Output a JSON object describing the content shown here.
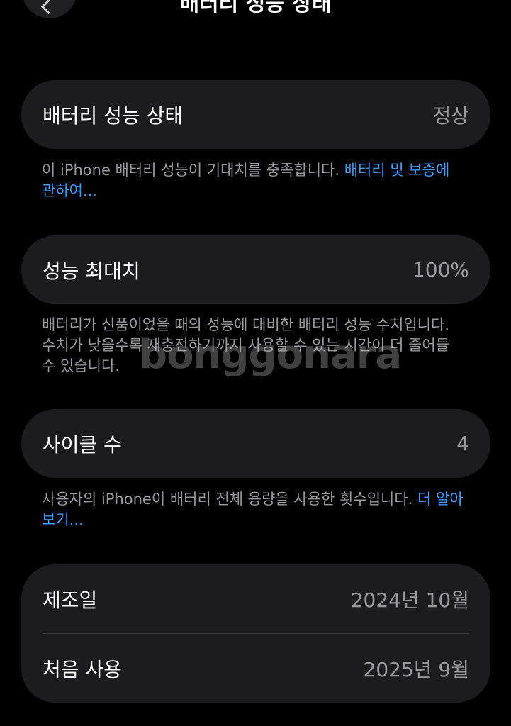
{
  "header": {
    "title": "배터리 성능 상태"
  },
  "health": {
    "label": "배터리 성능 상태",
    "value": "정상",
    "note_text": "이 iPhone 배터리 성능이 기대치를 충족합니다. ",
    "note_link": "배터리 및 보증에 관하여..."
  },
  "max_capacity": {
    "label": "성능 최대치",
    "value": "100%",
    "note_text": "배터리가 신품이었을 때의 성능에 대비한 배터리 성능 수치입니다. 수치가 낮을수록 재충전하기까지 사용할 수 있는 시간이 더 줄어들 수 있습니다."
  },
  "cycle_count": {
    "label": "사이클 수",
    "value": "4",
    "note_text": "사용자의 iPhone이 배터리 전체 용량을 사용한 횟수입니다. ",
    "note_link": "더 알아보기..."
  },
  "dates": {
    "manufacture_label": "제조일",
    "manufacture_value": "2024년 10월",
    "first_use_label": "처음 사용",
    "first_use_value": "2025년 9월"
  },
  "watermark": "bonggonara",
  "icons": {
    "back": "chevron-left-icon"
  }
}
